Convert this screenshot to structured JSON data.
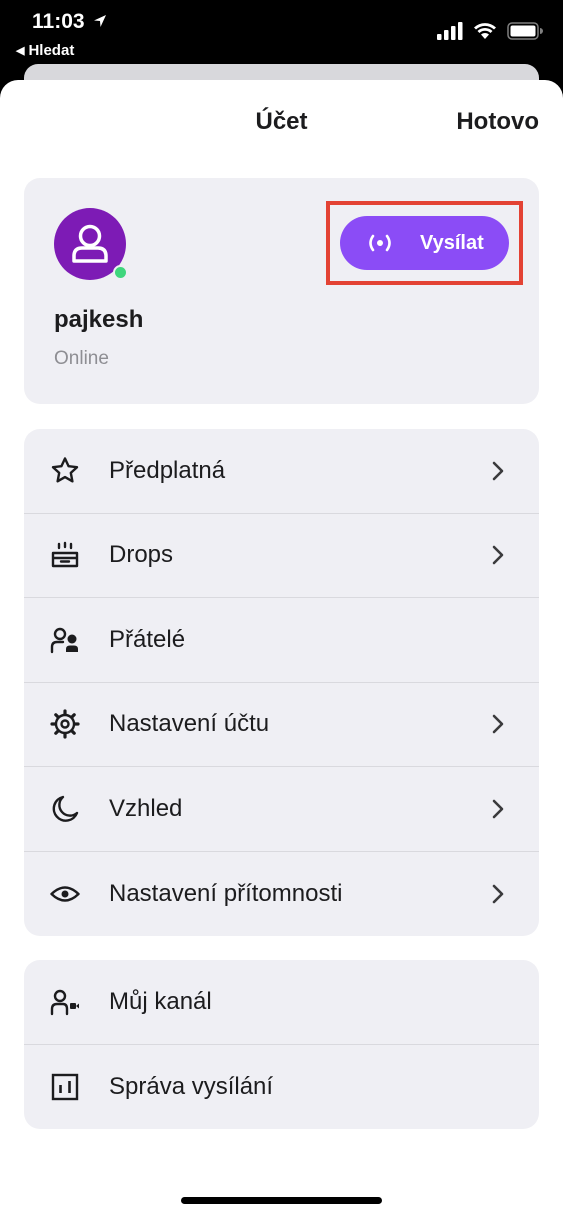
{
  "status_bar": {
    "time": "11:03",
    "back_app": "Hledat"
  },
  "header": {
    "title": "Účet",
    "done_label": "Hotovo"
  },
  "profile": {
    "username": "pajkesh",
    "status": "Online",
    "broadcast_label": "Vysílat"
  },
  "menu_primary": [
    {
      "label": "Předplatná",
      "icon": "star-icon",
      "chevron": true
    },
    {
      "label": "Drops",
      "icon": "drops-icon",
      "chevron": true
    },
    {
      "label": "Přátelé",
      "icon": "friends-icon",
      "chevron": false
    },
    {
      "label": "Nastavení účtu",
      "icon": "gear-icon",
      "chevron": true
    },
    {
      "label": "Vzhled",
      "icon": "moon-icon",
      "chevron": true
    },
    {
      "label": "Nastavení přítomnosti",
      "icon": "eye-icon",
      "chevron": true
    }
  ],
  "menu_secondary": [
    {
      "label": "Můj kanál",
      "icon": "channel-icon",
      "chevron": false
    },
    {
      "label": "Správa vysílání",
      "icon": "stream-manager-icon",
      "chevron": false
    }
  ],
  "colors": {
    "accent": "#8b4cf6",
    "avatar": "#7d1bb5",
    "online": "#3fd67d",
    "highlight": "#e34234"
  }
}
